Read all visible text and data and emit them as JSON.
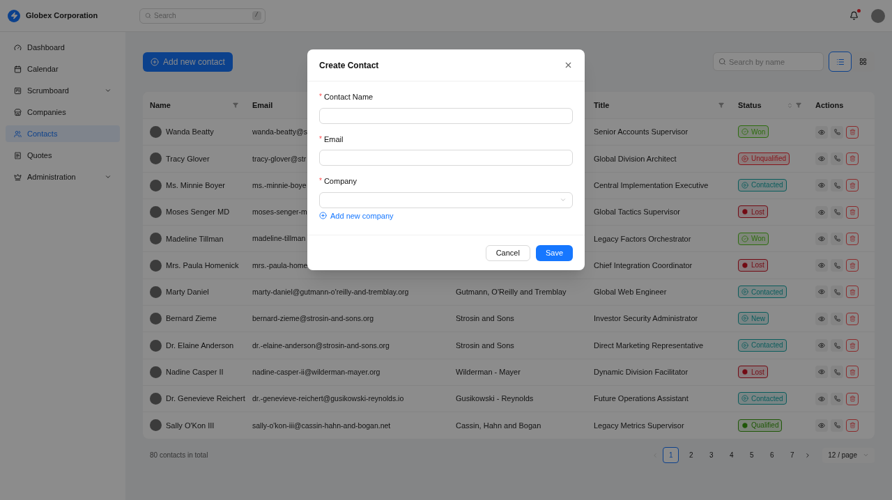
{
  "brand": {
    "name": "Globex Corporation"
  },
  "topbar": {
    "search": {
      "placeholder": "Search",
      "shortcut": "/"
    },
    "notification_dot": true
  },
  "sidebar": {
    "items": [
      {
        "label": "Dashboard",
        "selected": false,
        "expandable": false
      },
      {
        "label": "Calendar",
        "selected": false,
        "expandable": false
      },
      {
        "label": "Scrumboard",
        "selected": false,
        "expandable": true
      },
      {
        "label": "Companies",
        "selected": false,
        "expandable": false
      },
      {
        "label": "Contacts",
        "selected": true,
        "expandable": false
      },
      {
        "label": "Quotes",
        "selected": false,
        "expandable": false
      },
      {
        "label": "Administration",
        "selected": false,
        "expandable": true
      }
    ]
  },
  "toolbar": {
    "add_button": "Add new contact",
    "search": {
      "placeholder": "Search by name"
    },
    "views": [
      {
        "kind": "list",
        "selected": true
      },
      {
        "kind": "grid",
        "selected": false
      }
    ]
  },
  "table": {
    "columns": [
      {
        "label": "Name",
        "filter": true,
        "sort": false
      },
      {
        "label": "Email"
      },
      {
        "label": "Title",
        "filter": true,
        "sort": false
      },
      {
        "label": "Status",
        "filter": true,
        "sort": true
      },
      {
        "label": "Actions",
        "filter": false,
        "sort": false
      }
    ],
    "rows": [
      {
        "name": "Wanda Beatty",
        "email": "wanda-beatty@s",
        "title": "Senior Accounts Supervisor",
        "status": {
          "label": "Won",
          "color": "#2d6c0e",
          "kind": "check"
        }
      },
      {
        "name": "Tracy Glover",
        "email": "tracy-glover@str",
        "title": "Global Division Architect",
        "status": {
          "label": "Unqualified",
          "color": "#871319",
          "kind": "play"
        }
      },
      {
        "name": "Ms. Minnie Boyer",
        "email": "ms.-minnie-boye",
        "title": "Central Implementation Executive",
        "status": {
          "label": "Contacted",
          "color": "#0a5c5c",
          "kind": "play"
        }
      },
      {
        "name": "Moses Senger MD",
        "email": "moses-senger-m",
        "title": "Global Tactics Supervisor",
        "status": {
          "label": "Lost",
          "color": "#720a13",
          "kind": "filled"
        }
      },
      {
        "name": "Madeline Tillman",
        "email": "madeline-tillman",
        "title": "Legacy Factors Orchestrator",
        "status": {
          "label": "Won",
          "color": "#2d6c0e",
          "kind": "check"
        }
      },
      {
        "name": "Mrs. Paula Homenick",
        "email": "mrs.-paula-home",
        "title": "Chief Integration Coordinator",
        "status": {
          "label": "Lost",
          "color": "#720a13",
          "kind": "filled"
        }
      },
      {
        "name": "Marty Daniel",
        "email": "marty-daniel@gutmann-o'reilly-and-tremblay.org",
        "company": "Gutmann, O'Reilly and Tremblay",
        "title": "Global Web Engineer",
        "status": {
          "label": "Contacted",
          "color": "#0a5c5c",
          "kind": "play"
        }
      },
      {
        "name": "Bernard Zieme",
        "email": "bernard-zieme@strosin-and-sons.org",
        "company": "Strosin and Sons",
        "title": "Investor Security Administrator",
        "status": {
          "label": "New",
          "color": "#0a5c5c",
          "kind": "play"
        }
      },
      {
        "name": "Dr. Elaine Anderson",
        "email": "dr.-elaine-anderson@strosin-and-sons.org",
        "company": "Strosin and Sons",
        "title": "Direct Marketing Representative",
        "status": {
          "label": "Contacted",
          "color": "#0a5c5c",
          "kind": "play"
        }
      },
      {
        "name": "Nadine Casper II",
        "email": "nadine-casper-ii@wilderman-mayer.org",
        "company": "Wilderman - Mayer",
        "title": "Dynamic Division Facilitator",
        "status": {
          "label": "Lost",
          "color": "#720a13",
          "kind": "filled"
        }
      },
      {
        "name": "Dr. Genevieve Reichert",
        "email": "dr.-genevieve-reichert@gusikowski-reynolds.io",
        "company": "Gusikowski - Reynolds",
        "title": "Future Operations Assistant",
        "status": {
          "label": "Contacted",
          "color": "#0a5c5c",
          "kind": "play"
        }
      },
      {
        "name": "Sally O'Kon III",
        "email": "sally-o'kon-iii@cassin-hahn-and-bogan.net",
        "company": "Cassin, Hahn and Bogan",
        "title": "Legacy Metrics Supervisor",
        "status": {
          "label": "Qualified",
          "color": "#1f5707",
          "kind": "filled"
        }
      }
    ]
  },
  "footer": {
    "total": "80 contacts in total",
    "prev_disabled": true,
    "pages": [
      {
        "label": "1",
        "selected": true
      },
      {
        "label": "2",
        "selected": false
      },
      {
        "label": "3",
        "selected": false
      },
      {
        "label": "4",
        "selected": false
      },
      {
        "label": "5",
        "selected": false
      },
      {
        "label": "6",
        "selected": false
      },
      {
        "label": "7",
        "selected": false
      }
    ],
    "page_size": "12 / page"
  },
  "modal": {
    "title": "Create Contact",
    "fields": [
      {
        "label": "Contact Name",
        "required_mark": "*",
        "kind": "text"
      },
      {
        "label": "Email",
        "required_mark": "*",
        "kind": "text"
      },
      {
        "label": "Company",
        "required_mark": "*",
        "kind": "select"
      }
    ],
    "add_company": "Add new company",
    "buttons": [
      {
        "label": "Cancel",
        "kind": "default"
      },
      {
        "label": "Save",
        "kind": "primary"
      }
    ]
  }
}
